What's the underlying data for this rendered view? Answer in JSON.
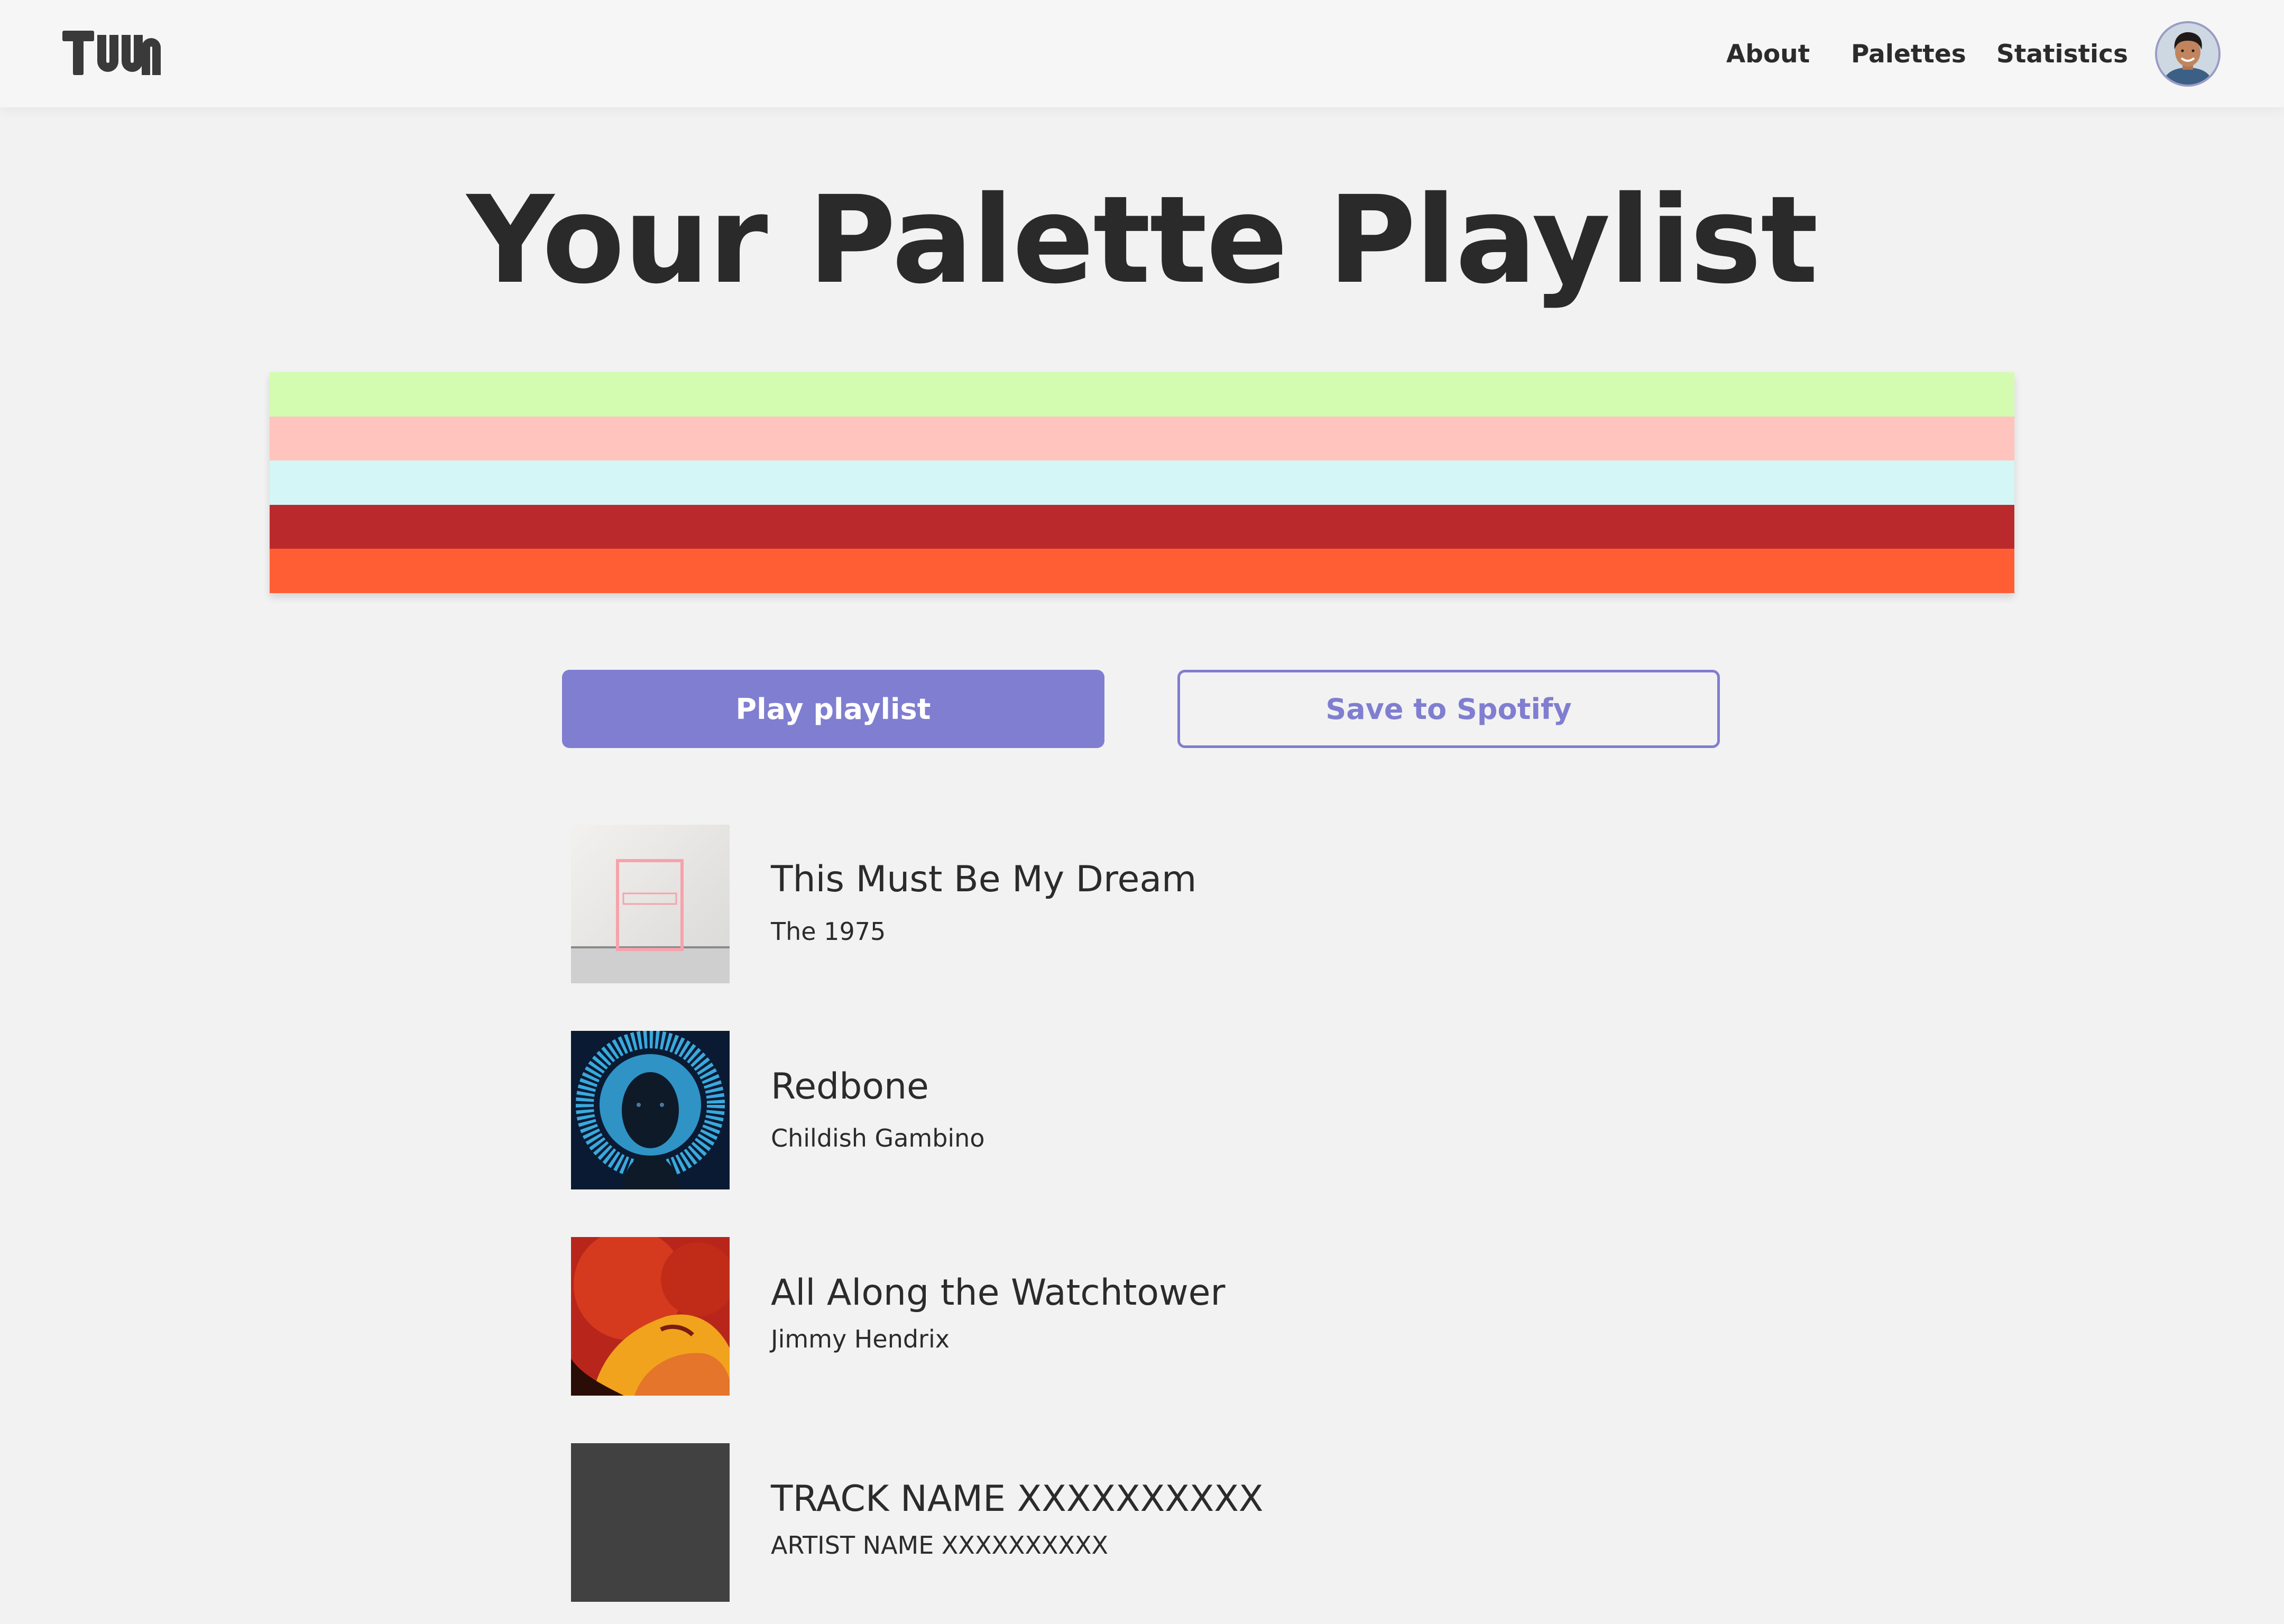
{
  "header": {
    "logo_text": "TUUN",
    "nav": [
      {
        "label": "About"
      },
      {
        "label": "Palettes"
      },
      {
        "label": "Statistics"
      }
    ]
  },
  "main": {
    "title": "Your Palette Playlist",
    "palette": [
      "#d4fcb0",
      "#ffc4be",
      "#d5f6f6",
      "#ba2a2d",
      "#ff5e35"
    ],
    "buttons": {
      "play_label": "Play playlist",
      "save_label": "Save to Spotify"
    },
    "tracks": [
      {
        "name": "This Must Be My Dream",
        "artist": "The 1975"
      },
      {
        "name": "Redbone",
        "artist": "Childish Gambino"
      },
      {
        "name": "All Along the Watchtower",
        "artist": "Jimmy Hendrix"
      },
      {
        "name": "TRACK NAME XXXXXXXXXX",
        "artist": "ARTIST NAME XXXXXXXXXX"
      }
    ]
  },
  "colors": {
    "accent": "#807ed0",
    "background": "#f2f2f2",
    "header_background": "#f6f6f6",
    "text": "#2b2b2b",
    "placeholder_cover": "#414141"
  }
}
